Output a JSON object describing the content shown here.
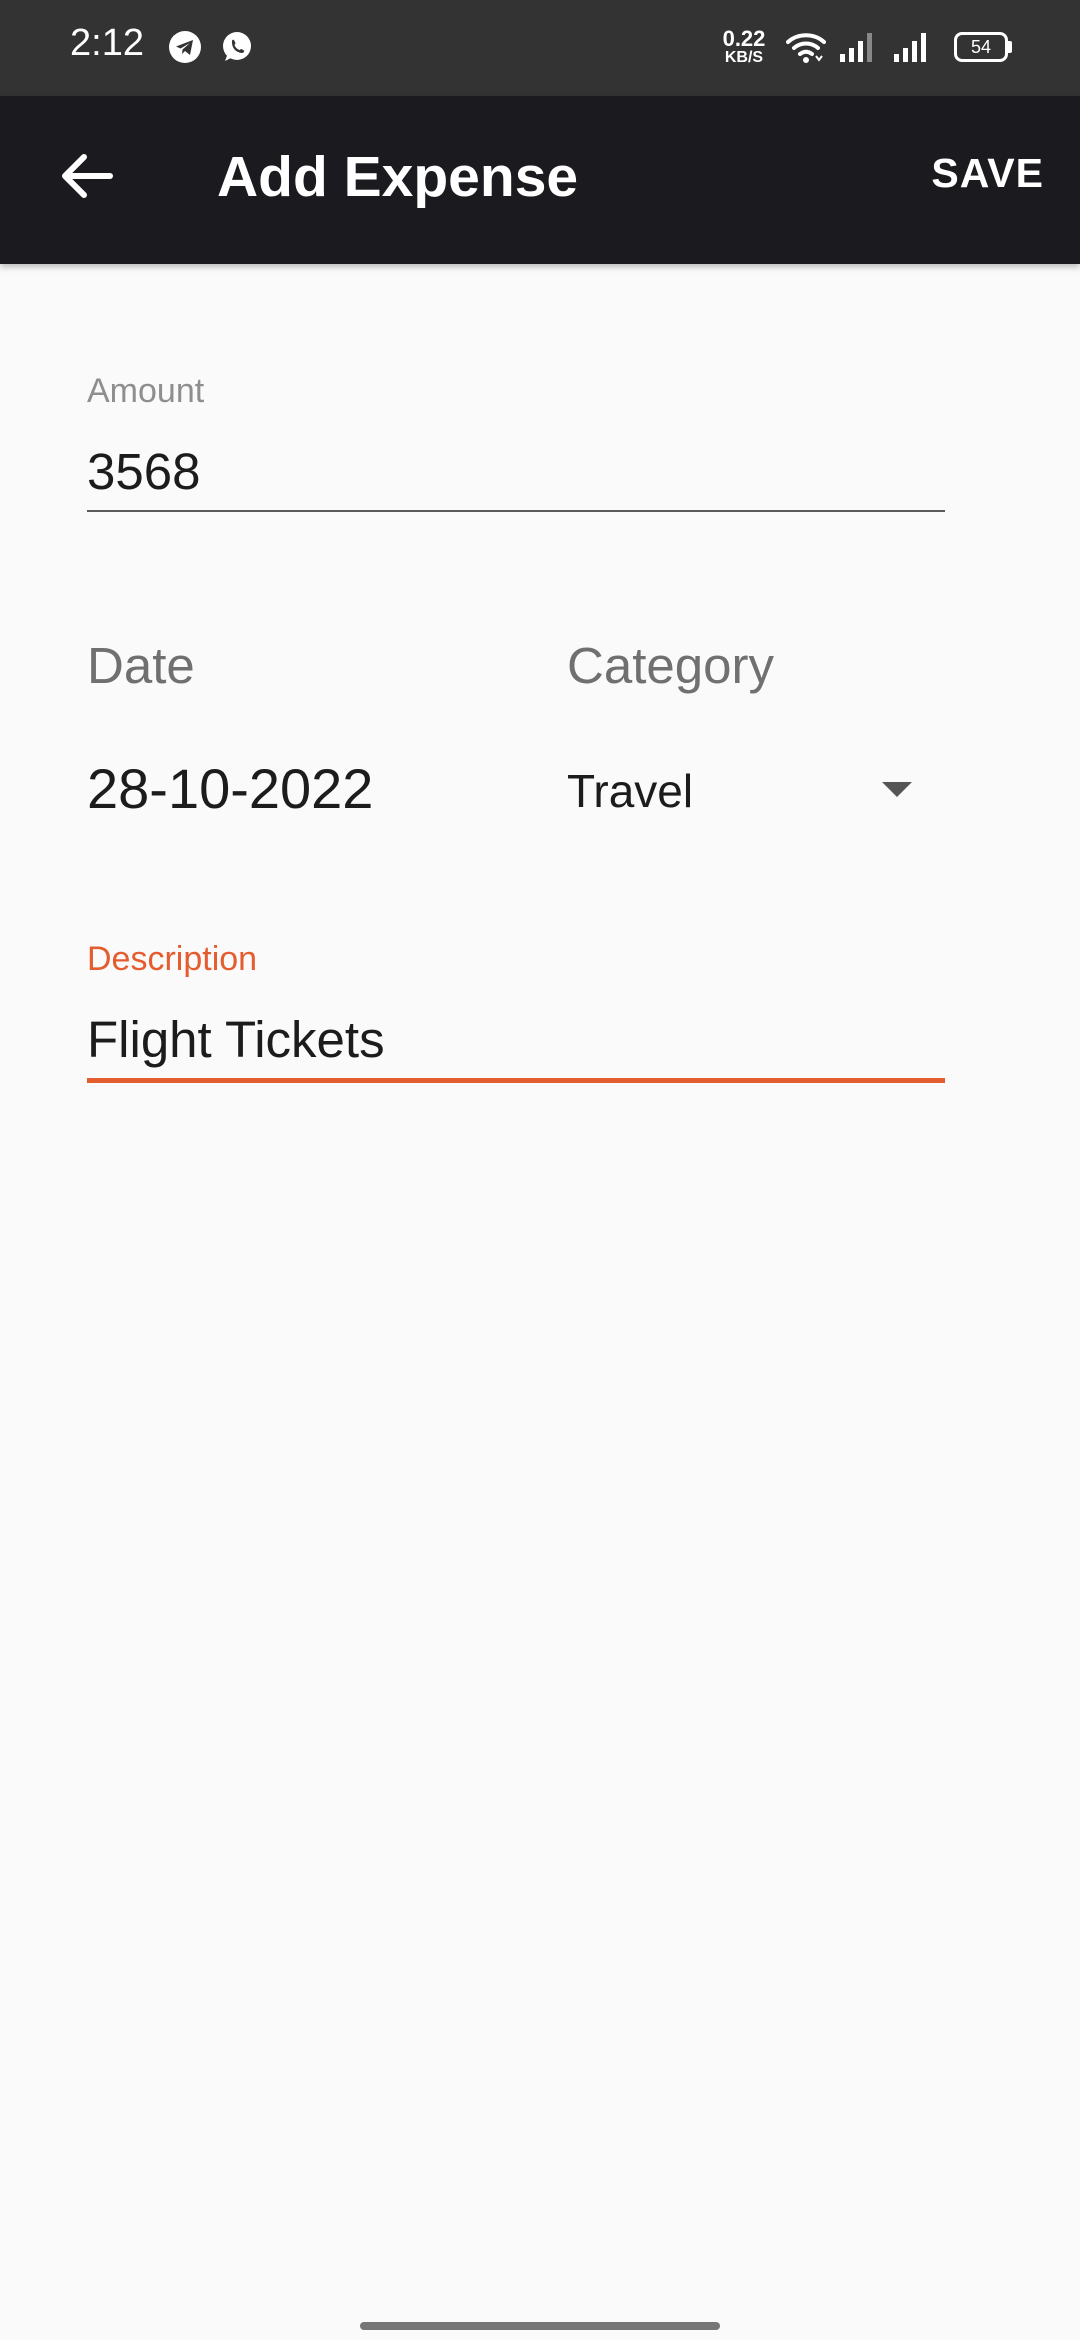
{
  "status_bar": {
    "time": "2:12",
    "net_speed_value": "0.22",
    "net_speed_unit": "KB/S",
    "battery": "54",
    "icons": [
      "telegram-icon",
      "whatsapp-icon",
      "wifi-icon",
      "signal-icon",
      "signal-icon",
      "battery-icon"
    ]
  },
  "app_bar": {
    "title": "Add Expense",
    "save_label": "SAVE",
    "back_icon": "arrow-left-icon"
  },
  "form": {
    "amount_label": "Amount",
    "amount_value": "3568",
    "date_label": "Date",
    "date_value": "28-10-2022",
    "category_label": "Category",
    "category_value": "Travel",
    "description_label": "Description",
    "description_value": "Flight Tickets"
  },
  "colors": {
    "app_bar": "#1b1b1f",
    "status_bar": "#333333",
    "background": "#fafafa",
    "accent": "#e35d2f"
  }
}
